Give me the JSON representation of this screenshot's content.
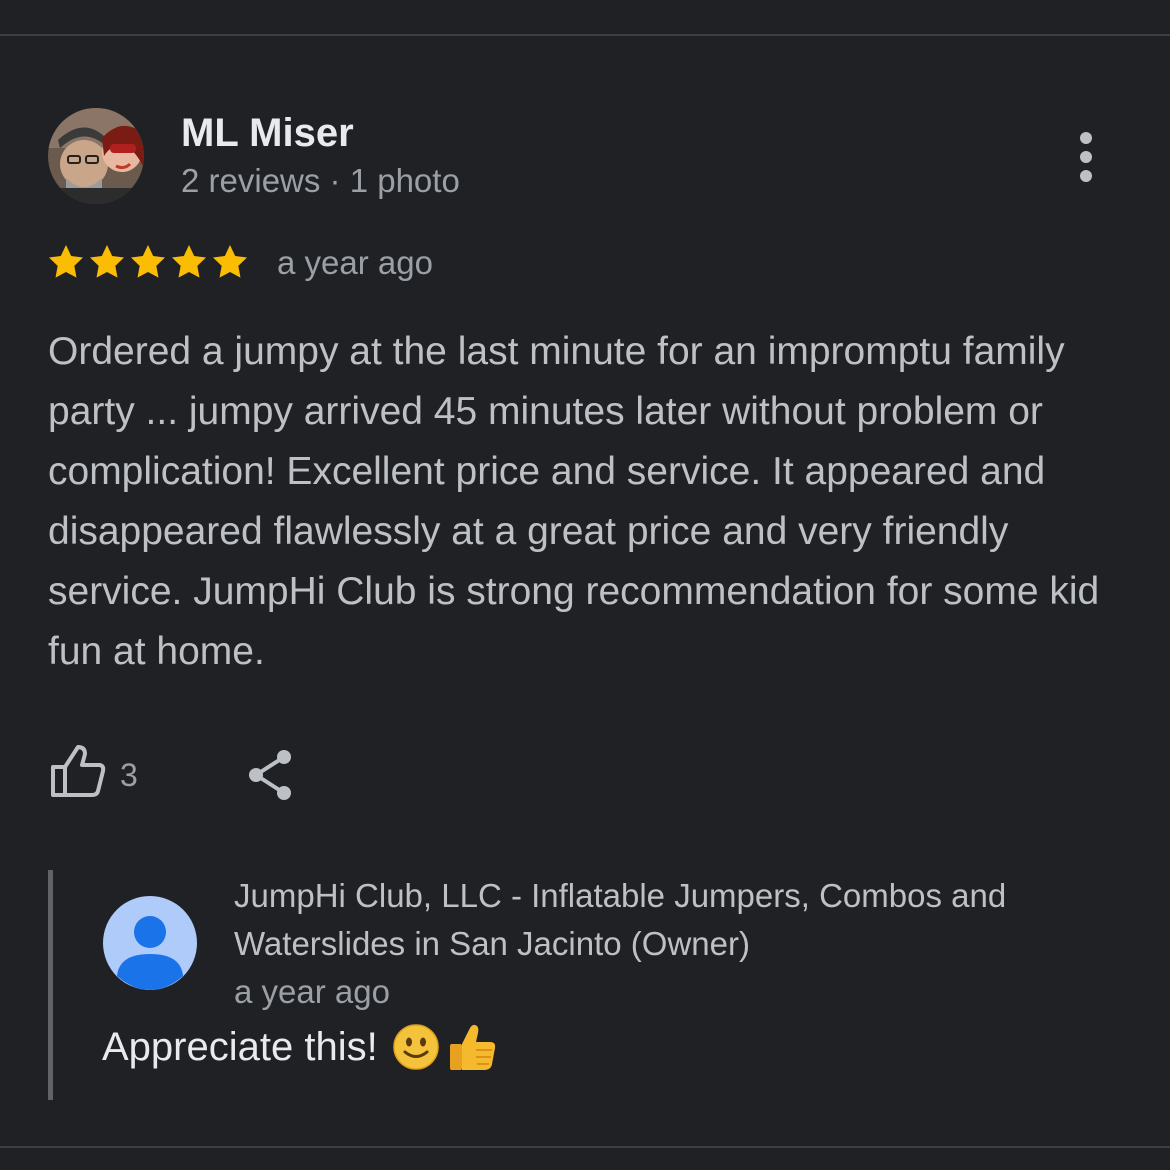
{
  "review": {
    "author_name": "ML Miser",
    "author_meta": "2 reviews · 1 photo",
    "rating": 5,
    "date": "a year ago",
    "text": "Ordered a jumpy at the last minute for an impromptu family party ... jumpy arrived 45 minutes later without problem or complication! Excellent price and service. It appeared and disappeared flawlessly at a great price and very friendly service. JumpHi Club is strong recommendation for some kid fun at home.",
    "like_count": "3"
  },
  "owner_response": {
    "name": "JumpHi Club, LLC - Inflatable Jumpers, Combos and Waterslides in San Jacinto (Owner)",
    "date": "a year ago",
    "text": "Appreciate this!",
    "emojis": [
      "slightly-smiling-face",
      "thumbs-up"
    ]
  },
  "icons": {
    "more": "more-vert-icon",
    "like": "thumb-up-outline-icon",
    "share": "share-icon"
  },
  "colors": {
    "background": "#202124",
    "star": "#fbbc04",
    "primary_text": "#e8eaed",
    "secondary_text": "#9aa0a6",
    "owner_avatar_bg": "#aecbfa",
    "owner_avatar_fg": "#1a73e8"
  }
}
